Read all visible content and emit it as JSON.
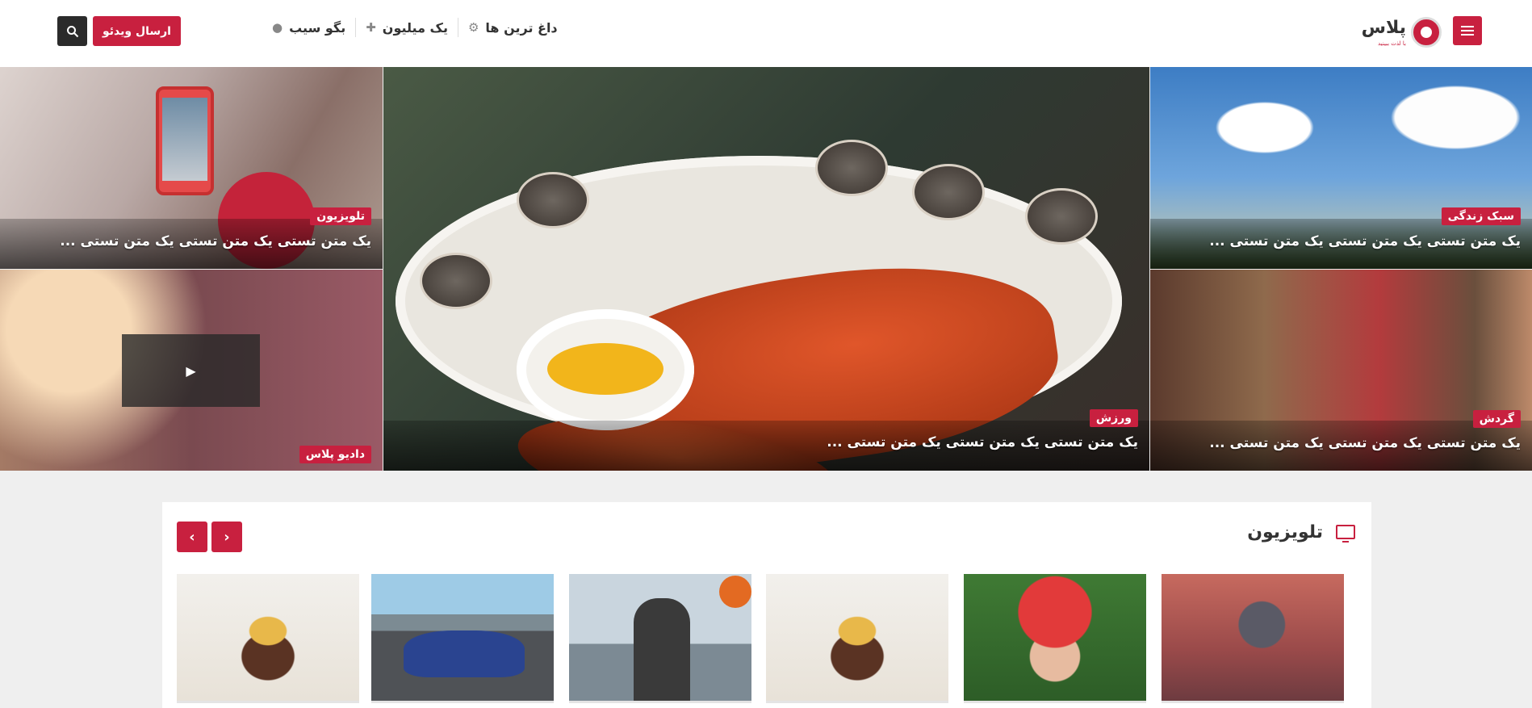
{
  "header": {
    "logo_text": "پلاس",
    "logo_subtext": "با لذت ببینید",
    "nav": [
      {
        "label": "داغ ترین ها",
        "icon": "gear-icon"
      },
      {
        "label": "یک میلیون",
        "icon": "plus-icon"
      },
      {
        "label": "بگو سیب",
        "icon": "apple-icon"
      }
    ],
    "send_video_label": "ارسال ویدئو"
  },
  "hero": {
    "sport_top": {
      "category": "سبک زندگی",
      "title": "یک متن تستی یک متن تستی یک متن تستی ..."
    },
    "tv": {
      "category": "تلویزیون",
      "title": "یک متن تستی یک متن تستی یک متن تستی ..."
    },
    "center": {
      "category": "ورزش",
      "title": "یک متن تستی یک متن تستی یک متن تستی ..."
    },
    "radio": {
      "category": "دادیو پلاس"
    },
    "travel": {
      "category": "گردش",
      "title": "یک متن تستی یک متن تستی یک متن تستی ..."
    }
  },
  "section": {
    "title": "تلویزیون",
    "prev_label": "‹",
    "next_label": "›"
  },
  "colors": {
    "accent": "#c8203f",
    "dark_button": "#2b2b2b",
    "page_bg": "#efefef"
  }
}
